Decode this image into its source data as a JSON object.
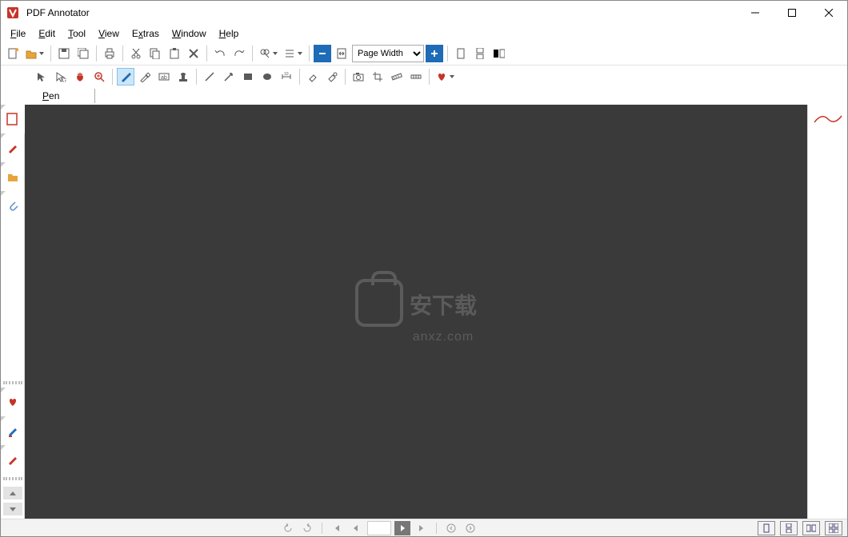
{
  "app": {
    "title": "PDF Annotator"
  },
  "menu": {
    "file": "File",
    "edit": "Edit",
    "tool": "Tool",
    "view": "View",
    "extras": "Extras",
    "window": "Window",
    "help": "Help"
  },
  "toolbar1": {
    "new": "new-document",
    "open": "open-file",
    "save": "save",
    "saveall": "save-all",
    "print": "print",
    "cut": "cut",
    "copy": "copy",
    "paste": "paste",
    "delete": "delete",
    "undo": "undo",
    "redo": "redo",
    "find": "find",
    "options": "options",
    "zoom_out": "zoom-out",
    "fit": "fit-page",
    "zoom_value": "Page Width",
    "zoom_in": "zoom-in",
    "single": "single-page",
    "continuous": "continuous",
    "twopage": "two-page"
  },
  "toolbar2": {
    "pointer": "pointer",
    "select": "select",
    "pan": "pan",
    "magnify": "magnify",
    "pen": "pen",
    "marker": "marker",
    "textbox": "text-box",
    "stamp": "stamp",
    "line": "line",
    "arrow": "arrow",
    "rect": "rectangle",
    "ellipse": "ellipse",
    "dimension": "dimension",
    "eraser": "eraser",
    "erase-area": "erase-area",
    "camera": "camera",
    "crop": "crop",
    "ruler": "ruler",
    "measure": "measure",
    "favorite": "favorite"
  },
  "tool_label": "Pen",
  "sidebar": {
    "pages": "pages-panel",
    "annotations": "annotations-panel",
    "bookmarks": "bookmarks-panel",
    "attachments": "attachments-panel",
    "favorites": "favorites-panel",
    "pen_history": "pen-history",
    "marker_history": "marker-history"
  },
  "watermark": {
    "cn": "安下载",
    "en": "anxz.com"
  },
  "statusbar": {
    "rotate_left": "rotate-left",
    "rotate_right": "rotate-right",
    "first": "first-page",
    "prev": "previous-page",
    "page": "page-indicator",
    "next": "next-page",
    "last": "last-page",
    "back": "nav-back",
    "forward": "nav-forward",
    "view1": "layout-single",
    "view2": "layout-continuous",
    "view3": "layout-two-page",
    "view4": "layout-two-continuous"
  },
  "colors": {
    "accent": "#c63527",
    "blue": "#1e6bb8",
    "canvas": "#3a3a3a"
  }
}
